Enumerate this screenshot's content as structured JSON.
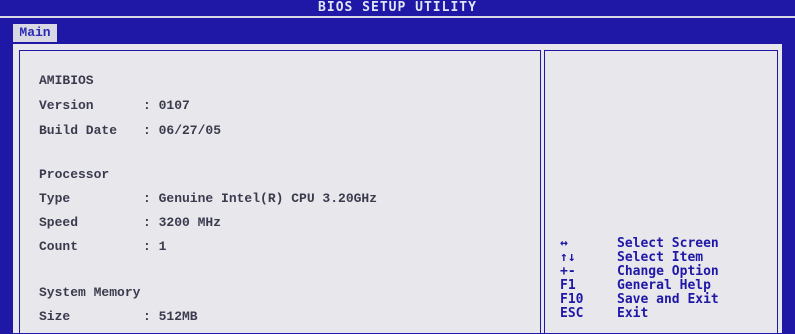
{
  "title": "BIOS SETUP UTILITY",
  "menu": {
    "tabs": [
      {
        "label": "Main",
        "active": true
      }
    ]
  },
  "info": {
    "amibios": {
      "heading": "AMIBIOS",
      "version": {
        "key": "Version",
        "value": ": 0107"
      },
      "build_date": {
        "key": "Build Date",
        "value": ": 06/27/05"
      }
    },
    "processor": {
      "heading": "Processor",
      "type": {
        "key": "Type",
        "value": ": Genuine Intel(R) CPU 3.20GHz"
      },
      "speed": {
        "key": "Speed",
        "value": ": 3200 MHz"
      },
      "count": {
        "key": "Count",
        "value": ": 1"
      }
    },
    "memory": {
      "heading": "System Memory",
      "size": {
        "key": "Size",
        "value": ": 512MB"
      }
    }
  },
  "help": [
    {
      "key": "↔",
      "action": "Select Screen"
    },
    {
      "key": "↑↓",
      "action": "Select Item"
    },
    {
      "key": "+-",
      "action": "Change Option"
    },
    {
      "key": "F1",
      "action": "General Help"
    },
    {
      "key": "F10",
      "action": "Save and Exit"
    },
    {
      "key": "ESC",
      "action": "Exit"
    }
  ],
  "colors": {
    "background": "#1f17a6",
    "panel": "#e7e7ec",
    "text": "#3b3b4e",
    "help_text": "#1f17a6"
  }
}
